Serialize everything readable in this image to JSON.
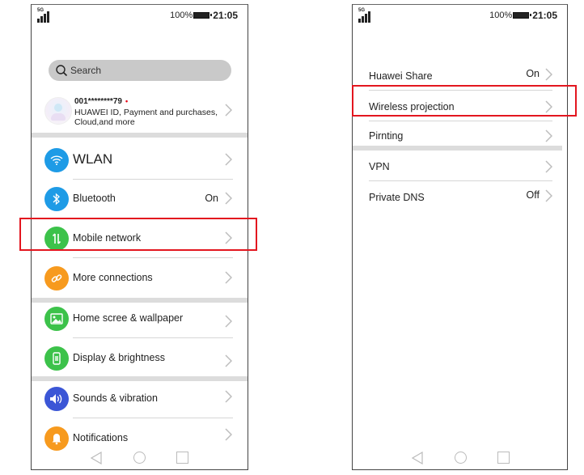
{
  "left_screen": {
    "status_bar": {
      "network": "5G",
      "battery": "100%",
      "time": "21:05"
    },
    "search": {
      "placeholder": "Search"
    },
    "account": {
      "id": "001********79",
      "notification_dot": "•",
      "description": "HUAWEI ID, Payment and purchases, Cloud,and more"
    },
    "groups": [
      {
        "items": [
          {
            "label": "WLAN",
            "value": "",
            "icon": "wifi-icon",
            "color": "#1e9be6"
          },
          {
            "label": "Bluetooth",
            "value": "On",
            "icon": "bluetooth-icon",
            "color": "#1e9be6"
          },
          {
            "label": "Mobile network",
            "value": "",
            "icon": "mobile-data-icon",
            "color": "#3cc24a",
            "highlighted": true
          },
          {
            "label": "More connections",
            "value": "",
            "icon": "link-icon",
            "color": "#f79a1e"
          }
        ]
      },
      {
        "items": [
          {
            "label": "Home scree & wallpaper",
            "value": "",
            "icon": "wallpaper-icon",
            "color": "#3cc24a"
          },
          {
            "label": "Display & brightness",
            "value": "",
            "icon": "display-icon",
            "color": "#3cc24a"
          }
        ]
      },
      {
        "items": [
          {
            "label": "Sounds & vibration",
            "value": "",
            "icon": "speaker-icon",
            "color": "#3b56d6"
          },
          {
            "label": "Notifications",
            "value": "",
            "icon": "bell-icon",
            "color": "#f79a1e"
          }
        ]
      }
    ]
  },
  "right_screen": {
    "status_bar": {
      "network": "5G",
      "battery": "100%",
      "time": "21:05"
    },
    "groups": [
      {
        "items": [
          {
            "label": "Huawei Share",
            "value": "On"
          },
          {
            "label": "Wireless projection",
            "value": "",
            "highlighted": true
          },
          {
            "label": "Pirnting",
            "value": ""
          }
        ]
      },
      {
        "items": [
          {
            "label": "VPN",
            "value": ""
          },
          {
            "label": "Private DNS",
            "value": "Off"
          }
        ]
      }
    ]
  },
  "colors": {
    "highlight": "#e3161f",
    "separator": "#dcdcdc",
    "search_bg": "#c9c9c9"
  }
}
